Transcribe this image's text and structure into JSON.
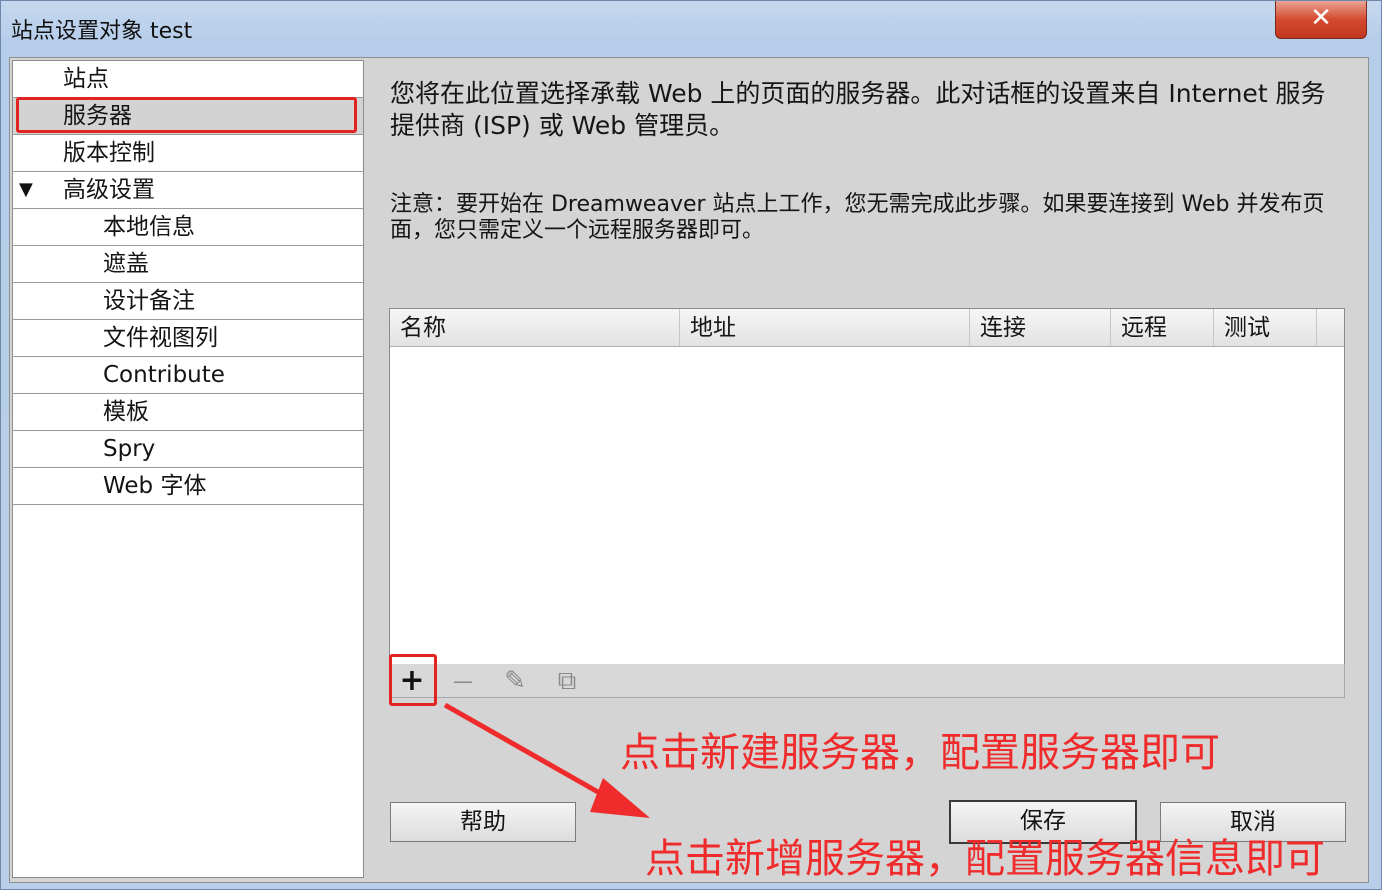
{
  "window": {
    "title": "站点设置对象 test",
    "close_label": "✕"
  },
  "sidebar": {
    "items": [
      {
        "label": "站点"
      },
      {
        "label": "服务器",
        "selected": true
      },
      {
        "label": "版本控制"
      },
      {
        "label": "高级设置",
        "expanded": true
      },
      {
        "label": "本地信息"
      },
      {
        "label": "遮盖"
      },
      {
        "label": "设计备注"
      },
      {
        "label": "文件视图列"
      },
      {
        "label": "Contribute"
      },
      {
        "label": "模板"
      },
      {
        "label": "Spry"
      },
      {
        "label": "Web 字体"
      }
    ],
    "expand_glyph": "▼"
  },
  "main": {
    "description": "您将在此位置选择承载 Web 上的页面的服务器。此对话框的设置来自 Internet 服务提供商 (ISP) 或 Web 管理员。",
    "note": "注意：要开始在 Dreamweaver 站点上工作，您无需完成此步骤。如果要连接到 Web 并发布页面，您只需定义一个远程服务器即可。",
    "table": {
      "columns": [
        "名称",
        "地址",
        "连接",
        "远程",
        "测试"
      ],
      "rows": []
    },
    "toolbar": {
      "add": "+",
      "remove": "—",
      "edit": "✎",
      "duplicate": "⧉"
    }
  },
  "buttons": {
    "help": "帮助",
    "save": "保存",
    "cancel": "取消"
  },
  "annotations": {
    "upper": "点击新建服务器，配置服务器即可",
    "lower": "点击新增服务器，配置服务器信息即可",
    "color": "#ef2b2b"
  }
}
